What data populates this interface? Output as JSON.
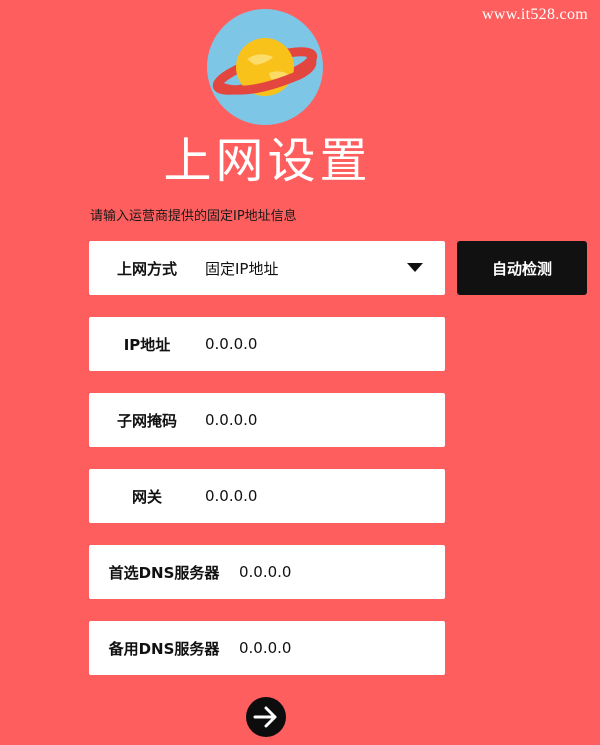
{
  "watermark": "www.it528.com",
  "page": {
    "title": "上网设置",
    "subtitle": "请输入运营商提供的固定IP地址信息"
  },
  "form": {
    "connection_type": {
      "label": "上网方式",
      "value": "固定IP地址"
    },
    "ip_address": {
      "label": "IP地址",
      "value": "0.0.0.0"
    },
    "subnet_mask": {
      "label": "子网掩码",
      "value": "0.0.0.0"
    },
    "gateway": {
      "label": "网关",
      "value": "0.0.0.0"
    },
    "primary_dns": {
      "label": "首选DNS服务器",
      "value": "0.0.0.0"
    },
    "secondary_dns": {
      "label": "备用DNS服务器",
      "value": "0.0.0.0"
    }
  },
  "buttons": {
    "auto_detect": "自动检测",
    "next_icon": "arrow-right-icon"
  },
  "icons": {
    "logo": "planet-icon",
    "dropdown": "caret-down-icon"
  },
  "colors": {
    "background": "#fe5e5d",
    "logo_circle": "#7ec6e6",
    "planet": "#f8c21a",
    "ring": "#e3453f",
    "button": "#111111",
    "field": "#ffffff"
  }
}
